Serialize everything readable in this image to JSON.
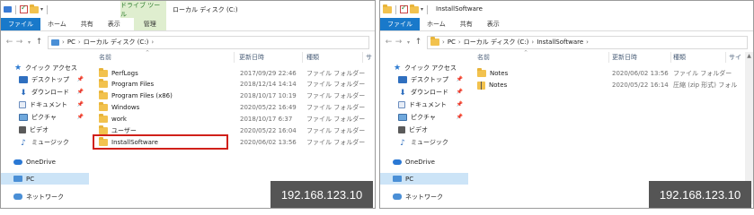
{
  "left": {
    "title": "ローカル ディスク (C:)",
    "context_tab_top": "ドライブ ツール",
    "ribbon_tabs": [
      "ファイル",
      "ホーム",
      "共有",
      "表示",
      "管理"
    ],
    "breadcrumb": [
      "PC",
      "ローカル ディスク (C:)"
    ],
    "nav": {
      "quick_access": "クイック アクセス",
      "items": [
        "デスクトップ",
        "ダウンロード",
        "ドキュメント",
        "ピクチャ",
        "ビデオ",
        "ミュージック"
      ],
      "onedrive": "OneDrive",
      "pc": "PC",
      "network": "ネットワーク"
    },
    "columns": {
      "name": "名前",
      "date": "更新日時",
      "type": "種類",
      "size": "サ"
    },
    "files": [
      {
        "name": "PerfLogs",
        "date": "2017/09/29 22:46",
        "type": "ファイル フォルダー"
      },
      {
        "name": "Program Files",
        "date": "2018/12/14 14:14",
        "type": "ファイル フォルダー"
      },
      {
        "name": "Program Files (x86)",
        "date": "2018/10/17 10:19",
        "type": "ファイル フォルダー"
      },
      {
        "name": "Windows",
        "date": "2020/05/22 16:49",
        "type": "ファイル フォルダー"
      },
      {
        "name": "work",
        "date": "2018/10/17 6:37",
        "type": "ファイル フォルダー"
      },
      {
        "name": "ユーザー",
        "date": "2020/05/22 16:04",
        "type": "ファイル フォルダー"
      },
      {
        "name": "InstallSoftware",
        "date": "2020/06/02 13:56",
        "type": "ファイル フォルダー"
      }
    ],
    "ip": "192.168.123.10"
  },
  "right": {
    "title": "InstallSoftware",
    "ribbon_tabs": [
      "ファイル",
      "ホーム",
      "共有",
      "表示"
    ],
    "breadcrumb": [
      "PC",
      "ローカル ディスク (C:)",
      "InstallSoftware"
    ],
    "nav": {
      "quick_access": "クイック アクセス",
      "items": [
        "デスクトップ",
        "ダウンロード",
        "ドキュメント",
        "ピクチャ",
        "ビデオ",
        "ミュージック"
      ],
      "onedrive": "OneDrive",
      "pc": "PC",
      "network": "ネットワーク"
    },
    "columns": {
      "name": "名前",
      "date": "更新日時",
      "type": "種類",
      "size": "サイ"
    },
    "files": [
      {
        "name": "Notes",
        "date": "2020/06/02 13:56",
        "type": "ファイル フォルダー",
        "icon": "folder-icon"
      },
      {
        "name": "Notes",
        "date": "2020/05/22 16:14",
        "type": "圧縮 (zip 形式) フォル",
        "icon": "zip-folder-icon"
      }
    ],
    "ip": "192.168.123.10"
  },
  "colors": {
    "file_tab": "#1979ca",
    "context_tab": "#dfeecf",
    "selected": "#cce4f7",
    "highlight": "#d0201a",
    "folder": "#f2c24e",
    "ip_badge": "#555555"
  }
}
